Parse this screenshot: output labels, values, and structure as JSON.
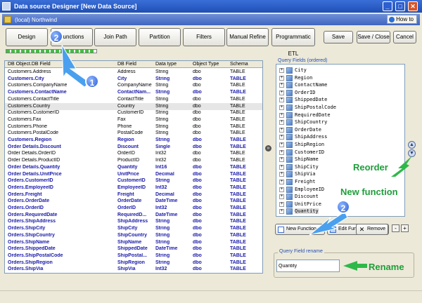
{
  "window": {
    "title": "Data source Designer [New Data Source]",
    "min": "_",
    "max": "□",
    "close": "✕"
  },
  "server": {
    "name": "(local) Northwind",
    "how_to": "How to"
  },
  "nav_tabs": [
    "Design",
    "Functions",
    "Join Path",
    "Partition",
    "Filters",
    "Manual Refine",
    "Programmatic ETL"
  ],
  "actions": {
    "save": "Save",
    "save_close": "Save / Close",
    "cancel": "Cancel"
  },
  "progress": {
    "fraction": 0.98
  },
  "grid": {
    "headers": [
      "DB Object.DB Field",
      "DB Field",
      "Data type",
      "Object Type",
      "Schema"
    ],
    "rows": [
      [
        "Customers.Address",
        "Address",
        "String",
        "dbo",
        "TABLE"
      ],
      [
        "Customers.City",
        "City",
        "String",
        "dbo",
        "TABLE"
      ],
      [
        "Customers.CompanyName",
        "CompanyName",
        "String",
        "dbo",
        "TABLE"
      ],
      [
        "Customers.ContactName",
        "ContactNam...",
        "String",
        "dbo",
        "TABLE"
      ],
      [
        "Customers.ContactTitle",
        "ContactTitle",
        "String",
        "dbo",
        "TABLE"
      ],
      [
        "Customers.Country",
        "Country",
        "String",
        "dbo",
        "TABLE"
      ],
      [
        "Customers.CustomerID",
        "CustomerID",
        "String",
        "dbo",
        "TABLE"
      ],
      [
        "Customers.Fax",
        "Fax",
        "String",
        "dbo",
        "TABLE"
      ],
      [
        "Customers.Phone",
        "Phone",
        "String",
        "dbo",
        "TABLE"
      ],
      [
        "Customers.PostalCode",
        "PostalCode",
        "String",
        "dbo",
        "TABLE"
      ],
      [
        "Customers.Region",
        "Region",
        "String",
        "dbo",
        "TABLE"
      ],
      [
        "Order Details.Discount",
        "Discount",
        "Single",
        "dbo",
        "TABLE"
      ],
      [
        "Order Details.OrderID",
        "OrderID",
        "Int32",
        "dbo",
        "TABLE"
      ],
      [
        "Order Details.ProductID",
        "ProductID",
        "Int32",
        "dbo",
        "TABLE"
      ],
      [
        "Order Details.Quantity",
        "Quantity",
        "Int16",
        "dbo",
        "TABLE"
      ],
      [
        "Order Details.UnitPrice",
        "UnitPrice",
        "Decimal",
        "dbo",
        "TABLE"
      ],
      [
        "Orders.CustomerID",
        "CustomerID",
        "String",
        "dbo",
        "TABLE"
      ],
      [
        "Orders.EmployeeID",
        "EmployeeID",
        "Int32",
        "dbo",
        "TABLE"
      ],
      [
        "Orders.Freight",
        "Freight",
        "Decimal",
        "dbo",
        "TABLE"
      ],
      [
        "Orders.OrderDate",
        "OrderDate",
        "DateTime",
        "dbo",
        "TABLE"
      ],
      [
        "Orders.OrderID",
        "OrderID",
        "Int32",
        "dbo",
        "TABLE"
      ],
      [
        "Orders.RequiredDate",
        "RequiredD...",
        "DateTime",
        "dbo",
        "TABLE"
      ],
      [
        "Orders.ShipAddress",
        "ShipAddress",
        "String",
        "dbo",
        "TABLE"
      ],
      [
        "Orders.ShipCity",
        "ShipCity",
        "String",
        "dbo",
        "TABLE"
      ],
      [
        "Orders.ShipCountry",
        "ShipCountry",
        "String",
        "dbo",
        "TABLE"
      ],
      [
        "Orders.ShipName",
        "ShipName",
        "String",
        "dbo",
        "TABLE"
      ],
      [
        "Orders.ShippedDate",
        "ShippedDate",
        "DateTime",
        "dbo",
        "TABLE"
      ],
      [
        "Orders.ShipPostalCode",
        "ShipPostal...",
        "String",
        "dbo",
        "TABLE"
      ],
      [
        "Orders.ShipRegion",
        "ShipRegion",
        "String",
        "dbo",
        "TABLE"
      ],
      [
        "Orders.ShipVia",
        "ShipVia",
        "Int32",
        "dbo",
        "TABLE"
      ]
    ],
    "bold_rows": [
      1,
      3,
      10,
      11,
      14,
      15,
      16,
      17,
      18,
      19,
      20,
      21,
      22,
      23,
      24,
      25,
      26,
      27,
      28,
      29
    ],
    "selected_row": 5
  },
  "query_fields": {
    "label": "Query Fields (ordered)",
    "items": [
      "City",
      "Region",
      "ContactName",
      "OrderID",
      "ShippedDate",
      "ShipPostalCode",
      "RequiredDate",
      "ShipCountry",
      "OrderDate",
      "ShipAddress",
      "ShipRegion",
      "CustomerID",
      "ShipName",
      "ShipCity",
      "ShipVia",
      "Freight",
      "EmployeeID",
      "Discount",
      "UnitPrice",
      "Quantity"
    ],
    "selected": 19,
    "expander": "+"
  },
  "buttons": {
    "new_function": "New Function",
    "edit_function": "Edit Function",
    "remove": "Remove",
    "minus": "-",
    "plus": "+",
    "move_right": "»",
    "reorder_up": "▲",
    "reorder_down": "▼",
    "remove_glyph": "✕"
  },
  "rename": {
    "legend": "Query Field rename",
    "value": "Quantity"
  },
  "annotations": {
    "badge_2": "2",
    "badge_1": "1",
    "reorder": "Reorder",
    "new_function": "New function",
    "rename": "Rename"
  },
  "colors": {
    "accent_blue": "#1a1aa8",
    "callout_green": "#1e9e3a",
    "badge_blue": "#2c5fd6"
  }
}
